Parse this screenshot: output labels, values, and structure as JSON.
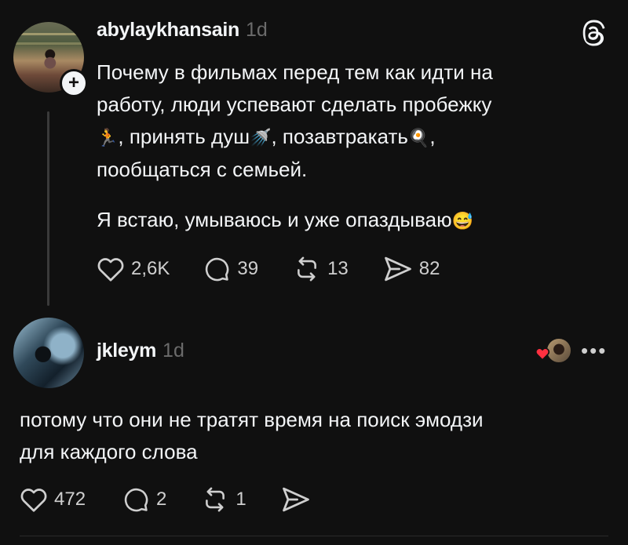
{
  "post": {
    "username": "abylaykhansain",
    "time": "1d",
    "paragraph1_line1": "Почему в фильмах перед тем как идти на",
    "paragraph1_line2": "работу, люди успевают сделать пробежку",
    "line3_part1": ", принять душ",
    "line3_part2": ", позавтракать",
    "line3_part3": ",",
    "line4": "пообщаться с семьей.",
    "paragraph2": "Я встаю, умываюсь и уже опаздываю",
    "emojis": {
      "run": "🏃",
      "shower": "🚿",
      "breakfast": "🍳",
      "sweat_smile": "😅"
    },
    "likes": "2,6K",
    "comments": "39",
    "reposts": "13",
    "shares": "82"
  },
  "reply": {
    "username": "jkleym",
    "time": "1d",
    "line1": "потому что они не тратят время на поиск эмодзи",
    "line2": "для каждого слова",
    "likes": "472",
    "comments": "2",
    "reposts": "1",
    "more": "•••"
  },
  "colors": {
    "background": "#101010",
    "text": "#f3f5f7",
    "muted": "#6b6b6b",
    "heart": "#ff3040"
  },
  "icons": [
    "threads-logo-icon",
    "plus-icon",
    "heart-icon",
    "comment-icon",
    "repost-icon",
    "share-icon",
    "more-icon"
  ]
}
